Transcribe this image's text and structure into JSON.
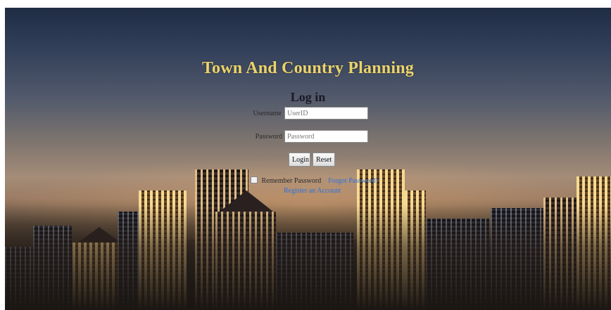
{
  "page": {
    "title": "Town And Country Planning",
    "heading": "Log in"
  },
  "form": {
    "username_label": "Username",
    "username_placeholder": "UserID",
    "password_label": "Password",
    "password_placeholder": "Password",
    "login_button": "Login",
    "reset_button": "Reset",
    "remember_label": "Remember Password",
    "forgot_link": "Forgot Password?",
    "register_link": "Register an Account"
  },
  "colors": {
    "title": "#ecd36a",
    "link": "#2f6fdc",
    "sky_top": "#1f2c44",
    "horizon": "#a48c78"
  },
  "icons": {
    "remember_checkbox": "checkbox-icon"
  }
}
